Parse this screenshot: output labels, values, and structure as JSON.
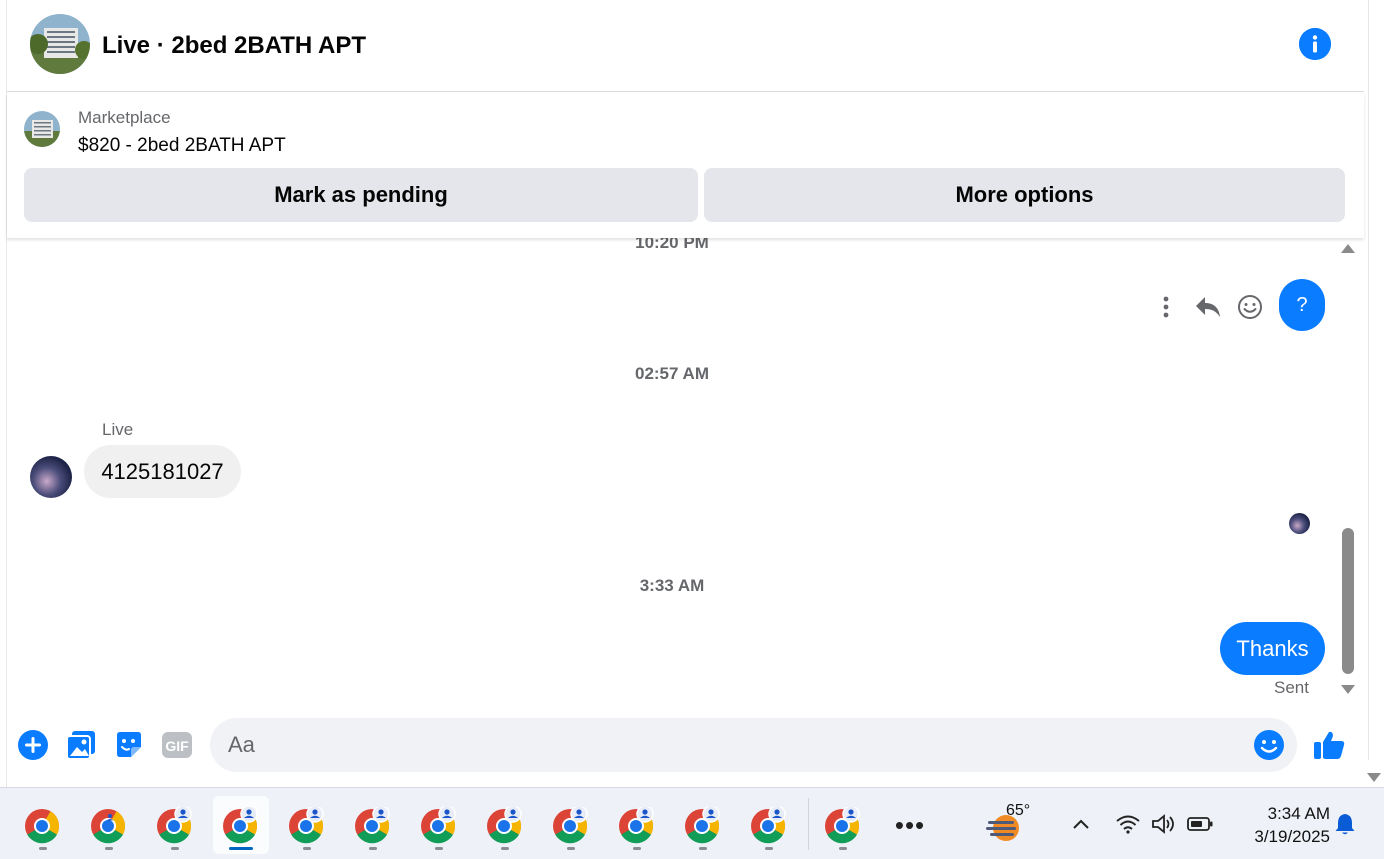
{
  "header": {
    "title": "Live · 2bed 2BATH APT"
  },
  "marketplace": {
    "label": "Marketplace",
    "listing": "$820 - 2bed 2BATH APT",
    "mark_pending_label": "Mark as pending",
    "more_options_label": "More options"
  },
  "conversation": {
    "timestamps": [
      "10:20 PM",
      "02:57 AM",
      "3:33 AM"
    ],
    "outgoing_question": "?",
    "incoming_sender": "Live",
    "incoming_message": "4125181027",
    "outgoing_thanks": "Thanks",
    "status": "Sent"
  },
  "composer": {
    "placeholder": "Aa",
    "icons": [
      "plus-icon",
      "photo-icon",
      "sticker-icon",
      "gif-icon",
      "emoji-icon",
      "thumbs-up-icon"
    ],
    "gif_label": "GIF"
  },
  "colors": {
    "accent": "#0a7cff",
    "bubble_in": "#f0f0f0",
    "button_bg": "#e4e6eb",
    "muted_text": "#65676b"
  },
  "taskbar": {
    "weather_temp": "65°",
    "more_label": "•••",
    "time": "3:34 AM",
    "date": "3/19/2025",
    "tray_icons": [
      "chevron-up-icon",
      "wifi-icon",
      "volume-icon",
      "battery-icon",
      "notification-bell-icon"
    ]
  }
}
